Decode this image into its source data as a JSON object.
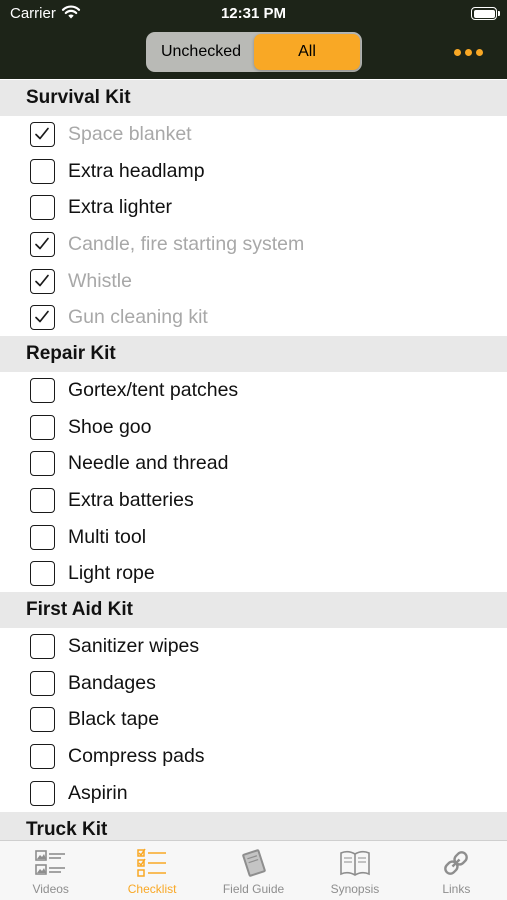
{
  "status": {
    "carrier": "Carrier",
    "time": "12:31 PM"
  },
  "segment": {
    "options": [
      "Unchecked",
      "All"
    ],
    "selected": "All"
  },
  "sections": [
    {
      "title": "Survival Kit",
      "items": [
        {
          "label": "Space blanket",
          "checked": true
        },
        {
          "label": "Extra headlamp",
          "checked": false
        },
        {
          "label": "Extra lighter",
          "checked": false
        },
        {
          "label": "Candle, fire starting system",
          "checked": true
        },
        {
          "label": "Whistle",
          "checked": true
        },
        {
          "label": "Gun cleaning kit",
          "checked": true
        }
      ]
    },
    {
      "title": "Repair Kit",
      "items": [
        {
          "label": "Gortex/tent patches",
          "checked": false
        },
        {
          "label": "Shoe goo",
          "checked": false
        },
        {
          "label": "Needle and thread",
          "checked": false
        },
        {
          "label": "Extra batteries",
          "checked": false
        },
        {
          "label": "Multi tool",
          "checked": false
        },
        {
          "label": "Light rope",
          "checked": false
        }
      ]
    },
    {
      "title": "First Aid Kit",
      "items": [
        {
          "label": "Sanitizer wipes",
          "checked": false
        },
        {
          "label": "Bandages",
          "checked": false
        },
        {
          "label": "Black tape",
          "checked": false
        },
        {
          "label": "Compress pads",
          "checked": false
        },
        {
          "label": "Aspirin",
          "checked": false
        }
      ]
    },
    {
      "title": "Truck Kit",
      "items": []
    }
  ],
  "tabs": [
    {
      "label": "Videos",
      "icon": "videos-list-icon",
      "active": false
    },
    {
      "label": "Checklist",
      "icon": "checklist-icon",
      "active": true
    },
    {
      "label": "Field Guide",
      "icon": "field-guide-book-icon",
      "active": false
    },
    {
      "label": "Synopsis",
      "icon": "open-book-icon",
      "active": false
    },
    {
      "label": "Links",
      "icon": "link-chain-icon",
      "active": false
    }
  ],
  "colors": {
    "accent": "#f9a825",
    "header_bg": "#1d2418",
    "section_bg": "#e8e8e8",
    "checked_text": "#a8a8a8"
  }
}
